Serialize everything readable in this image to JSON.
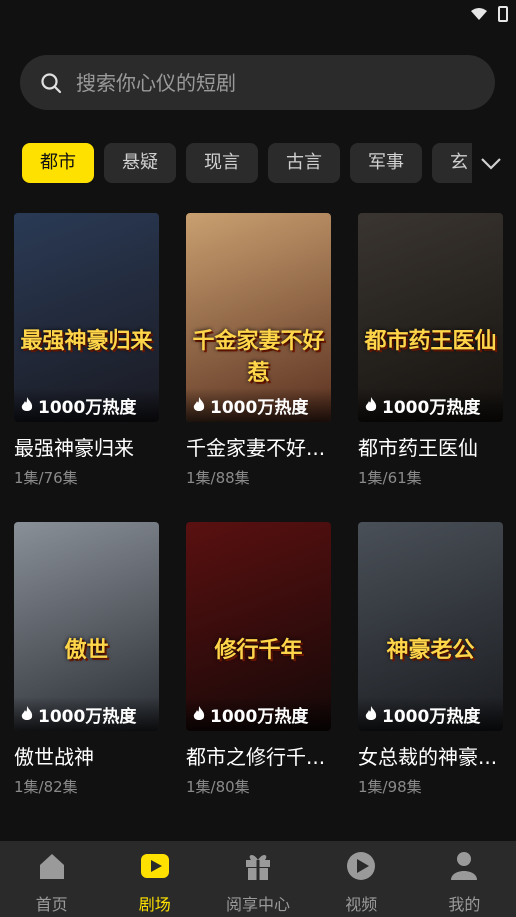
{
  "search": {
    "placeholder": "搜索你心仪的短剧"
  },
  "categories": [
    "都市",
    "悬疑",
    "现言",
    "古言",
    "军事",
    "玄"
  ],
  "active_category": "都市",
  "dramas": [
    {
      "title": "最强神豪归来",
      "episodes": "1集/76集",
      "heat": "1000万热度",
      "poster_text": "最强神豪归来",
      "colors": [
        "#2a3a55",
        "#1a1a22"
      ]
    },
    {
      "title": "千金家妻不好...",
      "episodes": "1集/88集",
      "heat": "1000万热度",
      "poster_text": "千金家妻不好惹",
      "colors": [
        "#c9a070",
        "#5a3020"
      ]
    },
    {
      "title": "都市药王医仙",
      "episodes": "1集/61集",
      "heat": "1000万热度",
      "poster_text": "都市药王医仙",
      "colors": [
        "#3a3530",
        "#15120f"
      ]
    },
    {
      "title": "傲世战神",
      "episodes": "1集/82集",
      "heat": "1000万热度",
      "poster_text": "傲世",
      "colors": [
        "#8a9098",
        "#2a2e34"
      ]
    },
    {
      "title": "都市之修行千...",
      "episodes": "1集/80集",
      "heat": "1000万热度",
      "poster_text": "修行千年",
      "colors": [
        "#5a1010",
        "#150808"
      ]
    },
    {
      "title": "女总裁的神豪...",
      "episodes": "1集/98集",
      "heat": "1000万热度",
      "poster_text": "神豪老公",
      "colors": [
        "#4a5058",
        "#1a1c20"
      ]
    }
  ],
  "tabbar": [
    {
      "label": "首页",
      "icon": "home-icon"
    },
    {
      "label": "剧场",
      "icon": "theater-play-icon"
    },
    {
      "label": "阅享中心",
      "icon": "gift-icon"
    },
    {
      "label": "视频",
      "icon": "video-play-icon"
    },
    {
      "label": "我的",
      "icon": "user-icon"
    }
  ],
  "active_tab": "剧场",
  "colors": {
    "accent": "#ffe100",
    "background": "#111111",
    "surface": "#2b2b2b"
  }
}
